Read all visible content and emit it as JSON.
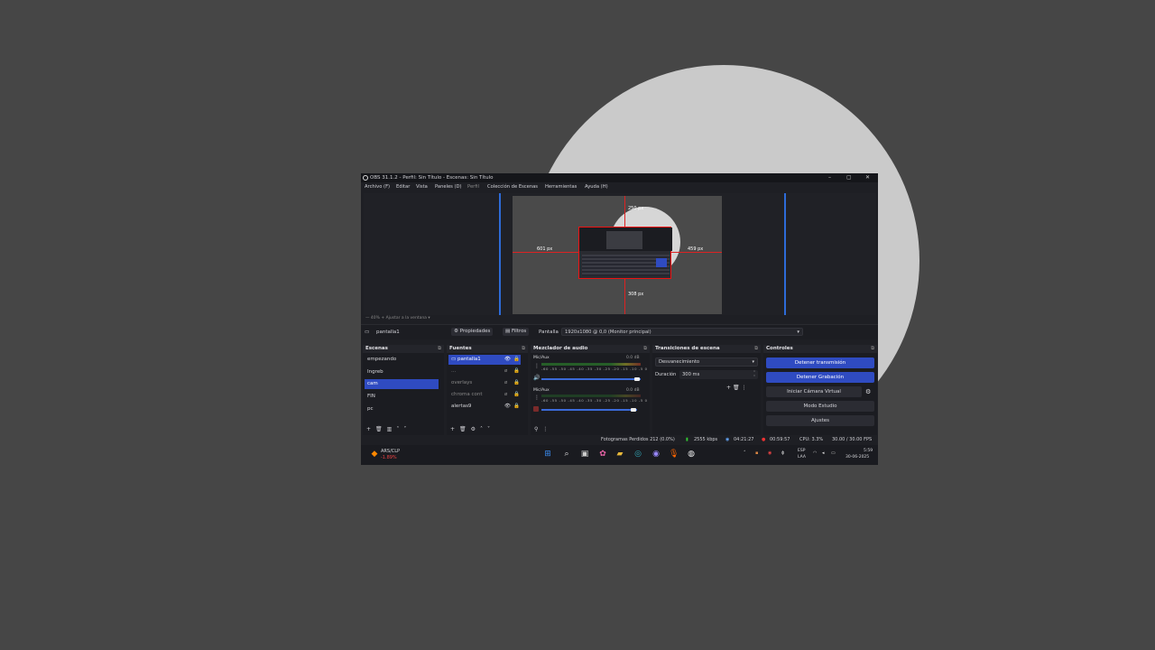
{
  "window": {
    "title": "OBS 31.1.2 - Perfil: Sin Título - Escenas: Sin Título",
    "controls": {
      "minimize": "–",
      "maximize": "▢",
      "close": "✕"
    }
  },
  "menu": [
    "Archivo (F)",
    "Editar",
    "Vista",
    "Paneles (D)",
    "Perfil",
    "Colección de Escenas",
    "Herramientas",
    "Ayuda (H)"
  ],
  "preview": {
    "labels": {
      "top": "250 px",
      "left": "601 px",
      "right": "459 px",
      "bottom": "308 px"
    },
    "zoom_text": "—  40%  +  Ajustar a la ventana  ▾"
  },
  "source_toolbar": {
    "source_name": "pantalla1",
    "properties": "Propiedades",
    "filters": "Filtros",
    "display_label": "Pantalla",
    "display_value": "1920x1080 @ 0,0 (Monitor principal)"
  },
  "docks": {
    "scenes": {
      "title": "Escenas",
      "items": [
        "empezando",
        "Ingreb",
        "cam",
        "FIN",
        "pc"
      ],
      "selected": 2
    },
    "sources": {
      "title": "Fuentes",
      "items": [
        "pantalla1",
        "...",
        "overlays",
        "chroma cont",
        "alertas9"
      ],
      "selected": 0
    },
    "mixer": {
      "title": "Mezclador de audio",
      "channels": [
        {
          "name": "Mic/Aux",
          "db": "0.0 dB"
        },
        {
          "name": "Mic/Aux",
          "db": "0.0 dB"
        }
      ],
      "scale": "-60 -55 -50 -45 -40 -35 -30 -25 -20 -15 -10 -5 0"
    },
    "transitions": {
      "title": "Transiciones de escena",
      "type": "Desvanecimiento",
      "duration_label": "Duración",
      "duration_value": "300 ms"
    },
    "controls": {
      "title": "Controles",
      "buttons": [
        "Detener transmisión",
        "Detener Grabación",
        "Iniciar Cámara Virtual",
        "Modo Estudio",
        "Ajustes"
      ]
    }
  },
  "status": {
    "dropped": "Fotogramas Perdidos 212 (0.0%)",
    "bitrate": "2555 kbps",
    "stream_time": "04:21:27",
    "rec_time": "00:59:57",
    "cpu": "CPU: 3.3%",
    "fps": "30.00 / 30.00 FPS"
  },
  "taskbar": {
    "ticker_name": "ARS/CLP",
    "ticker_change": "-1.89%",
    "lang_top": "ESP",
    "lang_bottom": "LAA",
    "time": "5:59",
    "date": "30-06-2025"
  },
  "colors": {
    "accent": "#2f4bc1",
    "guide": "#2d6bd8",
    "bg": "#464646",
    "window": "#1e1f24"
  }
}
